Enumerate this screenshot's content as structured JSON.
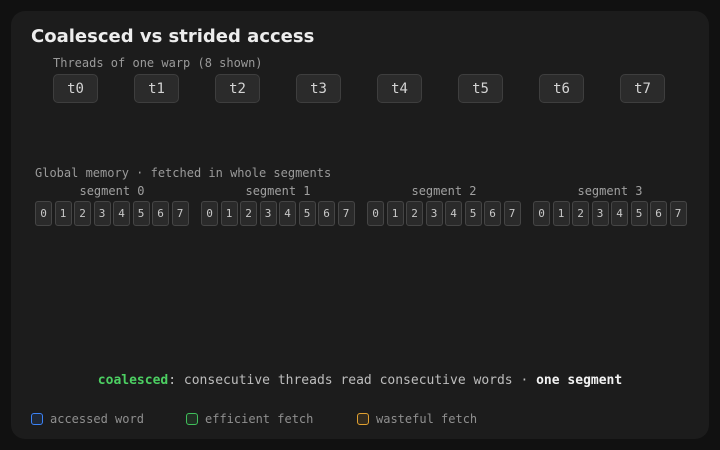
{
  "title": "Coalesced vs strided access",
  "warp": {
    "label": "Threads of one warp (8 shown)",
    "threads": [
      "t0",
      "t1",
      "t2",
      "t3",
      "t4",
      "t5",
      "t6",
      "t7"
    ]
  },
  "memory": {
    "label": "Global memory · fetched in whole segments",
    "segments": [
      {
        "label": "segment 0",
        "words": [
          "0",
          "1",
          "2",
          "3",
          "4",
          "5",
          "6",
          "7"
        ]
      },
      {
        "label": "segment 1",
        "words": [
          "0",
          "1",
          "2",
          "3",
          "4",
          "5",
          "6",
          "7"
        ]
      },
      {
        "label": "segment 2",
        "words": [
          "0",
          "1",
          "2",
          "3",
          "4",
          "5",
          "6",
          "7"
        ]
      },
      {
        "label": "segment 3",
        "words": [
          "0",
          "1",
          "2",
          "3",
          "4",
          "5",
          "6",
          "7"
        ]
      }
    ]
  },
  "caption": {
    "mode": "coalesced",
    "colon": ":",
    "text": " consecutive threads read consecutive words · ",
    "result": "one segment"
  },
  "legend": [
    {
      "label": "accessed word",
      "color": "#3b82f6"
    },
    {
      "label": "efficient fetch",
      "color": "#3fbf5a"
    },
    {
      "label": "wasteful fetch",
      "color": "#e0a030"
    }
  ],
  "colors": {
    "accent_green": "#4ccf62"
  }
}
